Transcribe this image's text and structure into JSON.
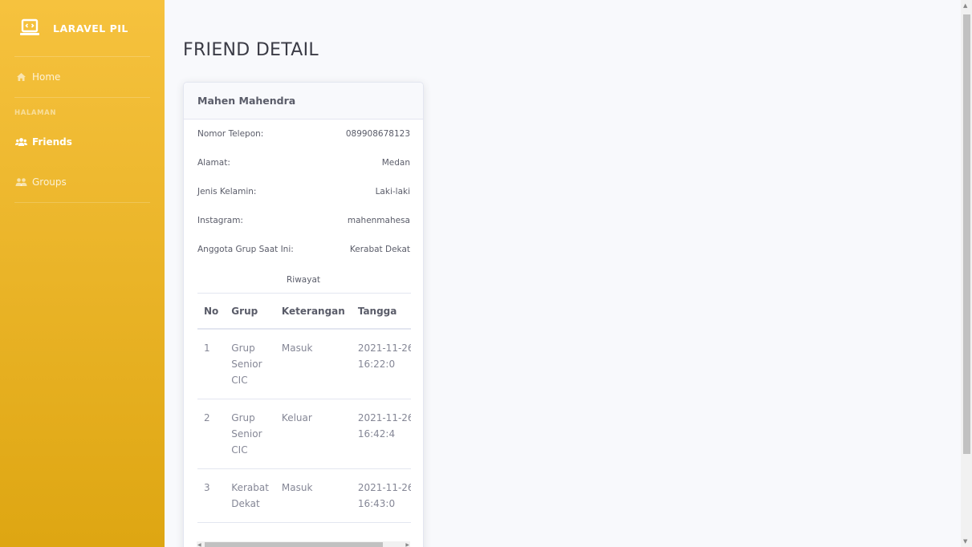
{
  "brand": {
    "name": "LARAVEL PIL",
    "icon": "laptop-code-icon"
  },
  "sidebar": {
    "home": {
      "label": "Home",
      "icon": "home-icon"
    },
    "section_heading": "HALAMAN",
    "items": [
      {
        "label": "Friends",
        "icon": "users-icon",
        "active": true
      },
      {
        "label": "Groups",
        "icon": "user-group-icon",
        "active": false
      }
    ]
  },
  "page": {
    "title": "FRIEND DETAIL"
  },
  "friend": {
    "name": "Mahen Mahendra",
    "fields": [
      {
        "label": "Nomor Telepon:",
        "value": "089908678123"
      },
      {
        "label": "Alamat:",
        "value": "Medan"
      },
      {
        "label": "Jenis Kelamin:",
        "value": "Laki-laki"
      },
      {
        "label": "Instagram:",
        "value": "mahenmahesa"
      },
      {
        "label": "Anggota Grup Saat Ini:",
        "value": "Kerabat Dekat"
      }
    ]
  },
  "history": {
    "title": "Riwayat",
    "columns": [
      "No",
      "Grup",
      "Keterangan",
      "Tangga"
    ],
    "rows": [
      {
        "no": "1",
        "grup": "Grup Senior CIC",
        "keterangan": "Masuk",
        "tanggal": "2021-11-26 16:22:0"
      },
      {
        "no": "2",
        "grup": "Grup Senior CIC",
        "keterangan": "Keluar",
        "tanggal": "2021-11-26 16:42:4"
      },
      {
        "no": "3",
        "grup": "Kerabat Dekat",
        "keterangan": "Masuk",
        "tanggal": "2021-11-26 16:43:0"
      }
    ]
  },
  "colors": {
    "sidebar_top": "#f6c23e",
    "sidebar_bottom": "#dea612",
    "background": "#f8f9fc"
  }
}
